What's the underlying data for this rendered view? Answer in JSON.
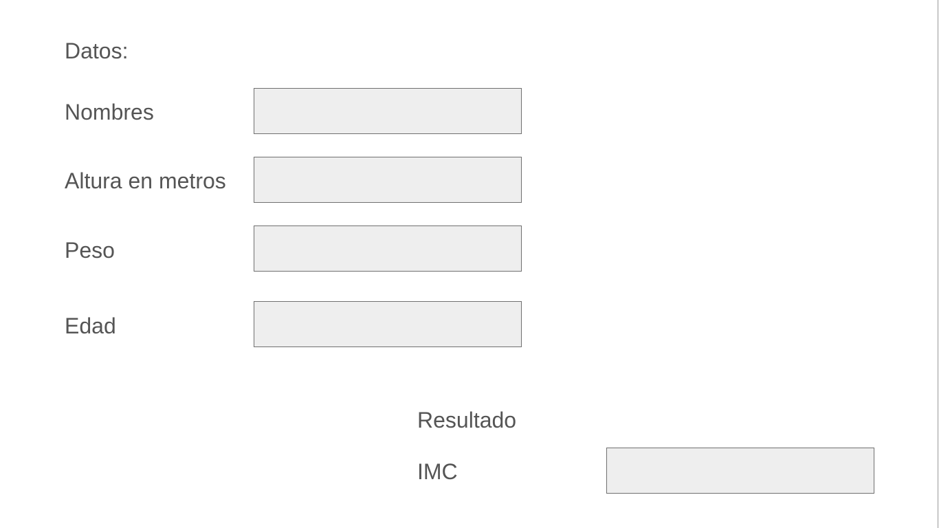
{
  "form": {
    "section_title": "Datos:",
    "fields": [
      {
        "label": "Nombres",
        "value": "",
        "placeholder": ""
      },
      {
        "label": "Altura en metros",
        "value": "",
        "placeholder": ""
      },
      {
        "label": "Peso",
        "value": "",
        "placeholder": ""
      },
      {
        "label": "Edad",
        "value": "",
        "placeholder": ""
      }
    ]
  },
  "result": {
    "title": "Resultado",
    "imc_label": "IMC",
    "imc_value": ""
  }
}
